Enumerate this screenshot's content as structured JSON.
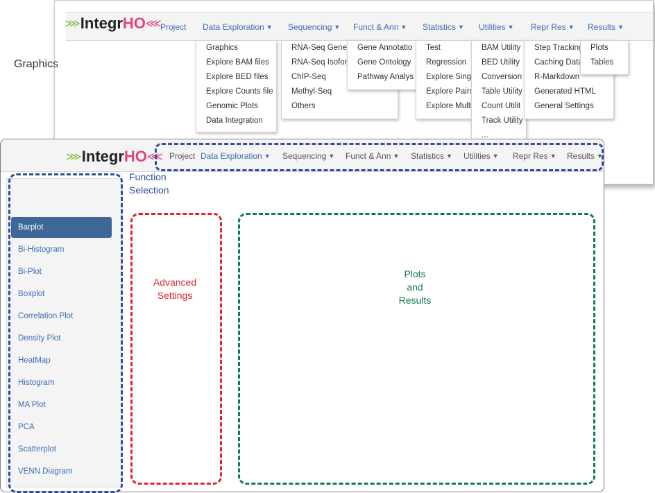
{
  "app": {
    "logo_text": "Integr",
    "logo_ho": "HO"
  },
  "nav": {
    "project": "Project",
    "data_exploration": "Data Exploration",
    "sequencing": "Sequencing",
    "funct_ann": "Funct & Ann",
    "statistics": "Statistics",
    "utilities": "Utilities",
    "repr_res": "Repr Res",
    "results": "Results"
  },
  "menus": {
    "data_exploration": [
      "Graphics",
      "Explore BAM files",
      "Explore BED files",
      "Explore Counts file",
      "Genomic Plots",
      "Data Integration"
    ],
    "sequencing": [
      "RNA-Seq Gene",
      "RNA-Seq Isofor",
      "ChIP-Seq",
      "Methyl-Seq",
      "Others"
    ],
    "funct_ann": [
      "Gene Annotatio",
      "Gene Ontology",
      "Pathway Analys"
    ],
    "statistics": [
      "Test",
      "Regression",
      "Explore Single",
      "Explore Pairs",
      "Explore Multi"
    ],
    "utilities": [
      "BAM Utility",
      "BED Utility",
      "Conversion",
      "Table Utility",
      "Count Utilit",
      "Track Utility",
      "..."
    ],
    "repr_res": [
      "Step Tracking",
      "Caching Data",
      "R-Markdown",
      "Generated HTML",
      "General Settings"
    ],
    "results": [
      "Plots",
      "Tables"
    ]
  },
  "sidebar": {
    "title": "Graphics",
    "items": [
      "Barplot",
      "Bi-Histogram",
      "Bi-Plot",
      "Boxplot",
      "Correlation Plot",
      "Density Plot",
      "HeatMap",
      "Histogram",
      "MA Plot",
      "PCA",
      "Scatterplot",
      "VENN Diagram"
    ],
    "active_index": 0
  },
  "annotations": {
    "function_selection": "Function\nSelection",
    "advanced_settings": "Advanced\nSettings",
    "plots_results": "Plots\nand\nResults"
  },
  "colors": {
    "annotation_blue": "#2e4d9b",
    "annotation_red": "#e0242c",
    "annotation_green": "#0e7d48",
    "active_item": "#3d6796",
    "link": "#3a6fb5",
    "logo_green": "#7dc242",
    "logo_pink": "#e0457b"
  }
}
